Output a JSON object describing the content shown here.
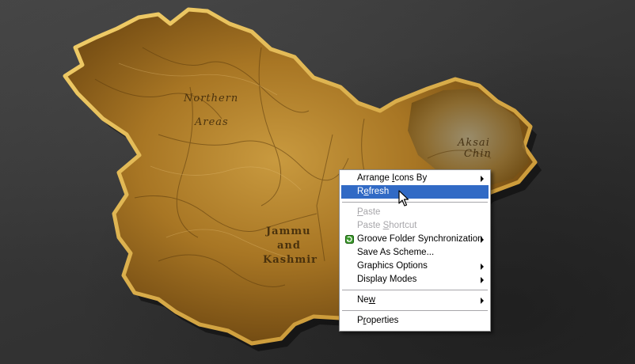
{
  "wallpaper": {
    "map_labels": {
      "northern_areas": [
        "Northern",
        "Areas"
      ],
      "jammu_kashmir": [
        "Jammu",
        "and",
        "Kashmir"
      ],
      "aksai_chin": [
        "Aksai",
        "Chin"
      ]
    },
    "colors": {
      "background": "#3a3a3a",
      "map_gold": "#b8862c",
      "map_dark": "#6b4a14"
    }
  },
  "context_menu": {
    "items": [
      {
        "pre": "Arrange ",
        "ul": "I",
        "post": "cons By",
        "submenu": true,
        "disabled": false,
        "highlighted": false
      },
      {
        "pre": "R",
        "ul": "e",
        "post": "fresh",
        "submenu": false,
        "disabled": false,
        "highlighted": true
      },
      {
        "separator": true
      },
      {
        "pre": "",
        "ul": "P",
        "post": "aste",
        "submenu": false,
        "disabled": true,
        "highlighted": false
      },
      {
        "pre": "Paste ",
        "ul": "S",
        "post": "hortcut",
        "submenu": false,
        "disabled": true,
        "highlighted": false
      },
      {
        "pre": "Groove Folder Synchronization",
        "ul": "",
        "post": "",
        "submenu": true,
        "disabled": false,
        "highlighted": false,
        "icon": "groove-sync-icon"
      },
      {
        "pre": "Save As Scheme...",
        "ul": "",
        "post": "",
        "submenu": false,
        "disabled": false,
        "highlighted": false
      },
      {
        "pre": "Graphics Options",
        "ul": "",
        "post": "",
        "submenu": true,
        "disabled": false,
        "highlighted": false
      },
      {
        "pre": "Display Modes",
        "ul": "",
        "post": "",
        "submenu": true,
        "disabled": false,
        "highlighted": false
      },
      {
        "separator": true
      },
      {
        "pre": "Ne",
        "ul": "w",
        "post": "",
        "submenu": true,
        "disabled": false,
        "highlighted": false
      },
      {
        "separator": true
      },
      {
        "pre": "P",
        "ul": "r",
        "post": "operties",
        "submenu": false,
        "disabled": false,
        "highlighted": false
      }
    ],
    "colors": {
      "highlight": "#316ac5",
      "disabled_text": "#a7a6aa"
    }
  },
  "cursor": {
    "icon": "arrow-pointer-icon"
  }
}
